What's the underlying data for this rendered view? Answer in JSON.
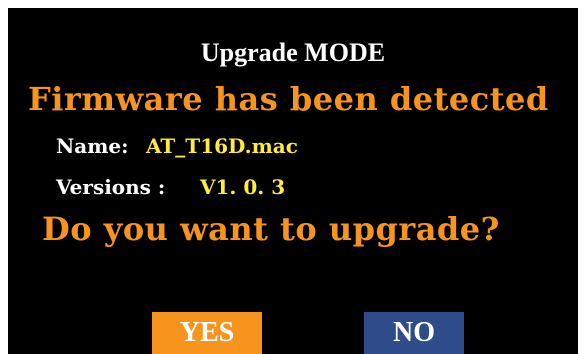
{
  "dialog": {
    "title": "Upgrade MODE",
    "message": "Firmware has been detected",
    "name_label": "Name:",
    "name_value": "AT_T16D.mac",
    "version_label": "Versions :",
    "version_value": "V1. 0. 3",
    "question": "Do you want to upgrade?",
    "yes_label": "YES",
    "no_label": "NO"
  },
  "colors": {
    "background": "#000000",
    "accent_orange": "#f7941d",
    "value_yellow": "#ffeb3b",
    "no_button_blue": "#2e4b8a",
    "text_white": "#ffffff"
  }
}
